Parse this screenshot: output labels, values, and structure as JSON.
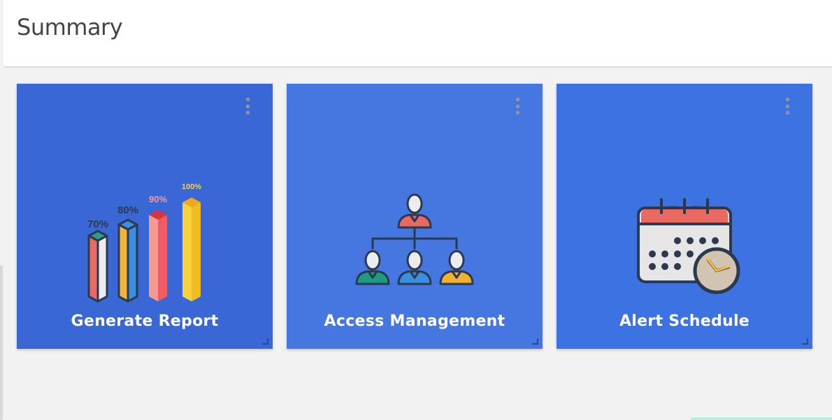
{
  "header": {
    "title": "Summary"
  },
  "colors": {
    "tile_generate": "#3a67d6",
    "tile_access": "#4677e0",
    "tile_alert": "#3c72e2"
  },
  "tiles": [
    {
      "label": "Generate Report",
      "icon": "bar-chart-report-icon",
      "bars": [
        {
          "label": "70%",
          "value": 70
        },
        {
          "label": "80%",
          "value": 80
        },
        {
          "label": "90%",
          "value": 90
        },
        {
          "label": "100%",
          "value": 100
        }
      ]
    },
    {
      "label": "Access Management",
      "icon": "org-chart-users-icon"
    },
    {
      "label": "Alert Schedule",
      "icon": "calendar-clock-icon"
    }
  ]
}
